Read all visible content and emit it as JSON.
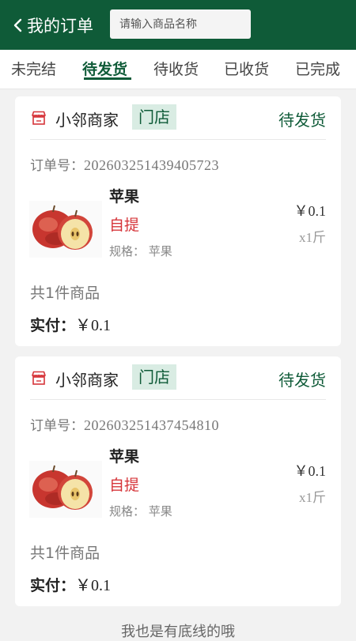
{
  "header": {
    "back_label": "我的订单",
    "search_placeholder": "请输入商品名称",
    "color": "#0f5b38"
  },
  "tabs": [
    {
      "label": "未完结",
      "active": false
    },
    {
      "label": "待发货",
      "active": true
    },
    {
      "label": "待收货",
      "active": false
    },
    {
      "label": "已收货",
      "active": false
    },
    {
      "label": "已完成",
      "active": false
    }
  ],
  "orders": [
    {
      "merchant": "小邻商家",
      "store_tag": "门店",
      "status": "待发货",
      "order_no_label": "订单号：",
      "order_no": "202603251439405723",
      "product_name": "苹果",
      "delivery": "自提",
      "spec_label": "规格：",
      "spec": "苹果",
      "price": "￥0.1",
      "quantity": "x1斤",
      "item_count": "共1件商品",
      "paid_label": "实付：",
      "paid_amount": "￥0.1"
    },
    {
      "merchant": "小邻商家",
      "store_tag": "门店",
      "status": "待发货",
      "order_no_label": "订单号：",
      "order_no": "202603251437454810",
      "product_name": "苹果",
      "delivery": "自提",
      "spec_label": "规格：",
      "spec": "苹果",
      "price": "￥0.1",
      "quantity": "x1斤",
      "item_count": "共1件商品",
      "paid_label": "实付：",
      "paid_amount": "￥0.1"
    }
  ],
  "footer_text": "我也是有底线的哦"
}
